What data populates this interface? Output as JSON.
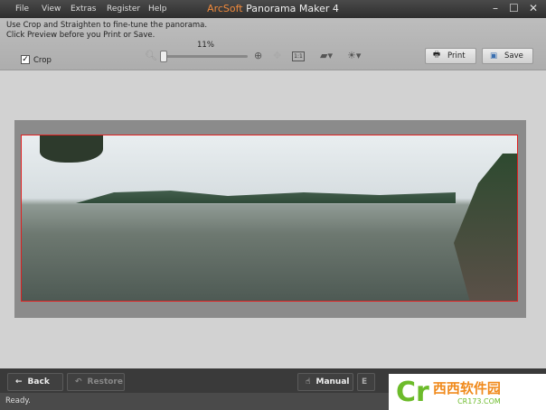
{
  "menu": [
    "File",
    "View",
    "Extras",
    "Register",
    "Help"
  ],
  "title": {
    "brand": "ArcSoft",
    "rest": " Panorama Maker 4"
  },
  "window_controls": {
    "minimize": "–",
    "maximize": "☐",
    "close": "✕"
  },
  "hint": [
    "Use Crop and Straighten to fine-tune the panorama.",
    "Click Preview before you Print or Save."
  ],
  "crop": {
    "label": "Crop",
    "checked": true,
    "mark": "✓"
  },
  "zoom": {
    "percent": "11%",
    "value": 11
  },
  "buttons": {
    "print": "Print",
    "save": "Save",
    "back": "Back",
    "restore": "Restore",
    "manual": "Manual"
  },
  "status": "Ready.",
  "watermark": {
    "text": "西西软件园",
    "url": "CR173.COM"
  },
  "colors": {
    "brand": "#f08a3c",
    "crop_border": "#e02020"
  }
}
